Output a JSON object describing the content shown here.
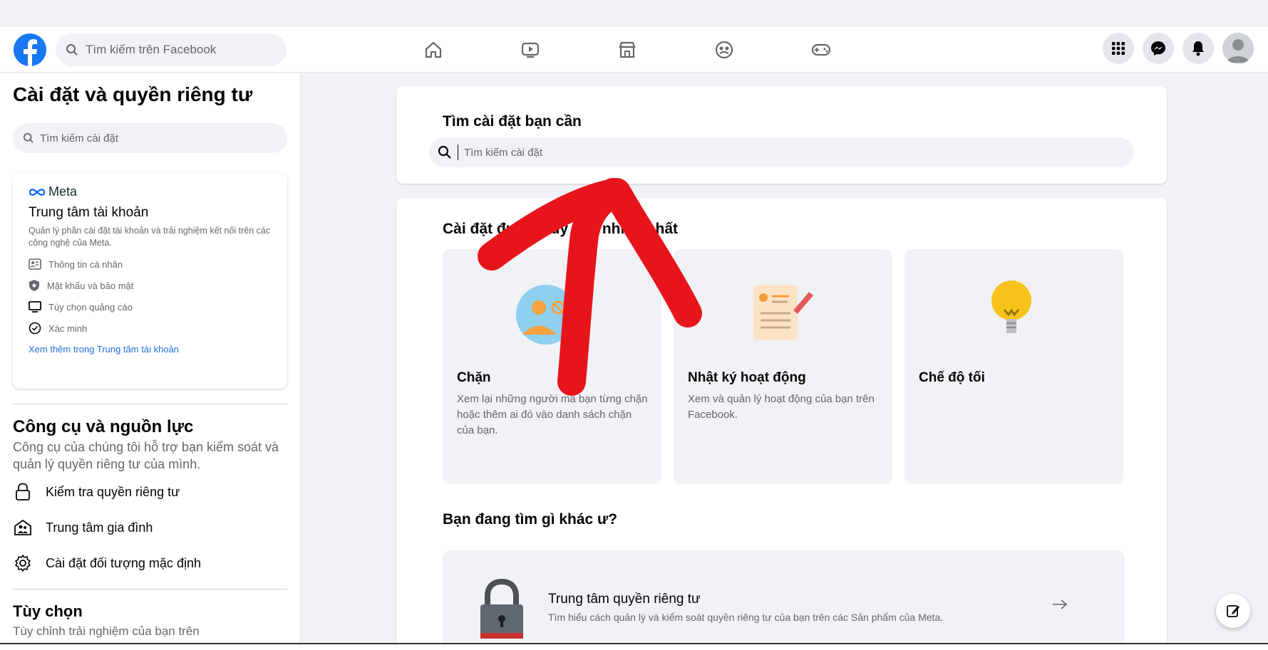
{
  "navbar": {
    "search_placeholder": "Tìm kiếm trên Facebook",
    "icons": [
      "home-icon",
      "video-icon",
      "marketplace-icon",
      "groups-icon",
      "gaming-icon"
    ],
    "right_icons": [
      "menu-grid-icon",
      "messenger-icon",
      "bell-icon",
      "avatar"
    ]
  },
  "sidebar": {
    "title": "Cài đặt và quyền riêng tư",
    "search_placeholder": "Tìm kiếm cài đặt",
    "meta_card": {
      "brand": "Meta",
      "title": "Trung tâm tài khoản",
      "description": "Quản lý phần cài đặt tài khoản và trải nghiệm kết nối trên các công nghệ của Meta.",
      "items": [
        {
          "label": "Thông tin cá nhân",
          "icon": "id-card-icon"
        },
        {
          "label": "Mật khẩu và bảo mật",
          "icon": "shield-icon"
        },
        {
          "label": "Tùy chọn quảng cáo",
          "icon": "monitor-icon"
        },
        {
          "label": "Xác minh",
          "icon": "check-circle-icon"
        }
      ],
      "link": "Xem thêm trong Trung tâm tài khoản"
    },
    "tools": {
      "heading": "Công cụ và nguồn lực",
      "subtitle": "Công cụ của chúng tôi hỗ trợ bạn kiểm soát và quản lý quyền riêng tư của mình.",
      "items": [
        {
          "label": "Kiểm tra quyền riêng tư",
          "icon": "lock-icon"
        },
        {
          "label": "Trung tâm gia đình",
          "icon": "family-icon"
        },
        {
          "label": "Cài đặt đối tượng mặc định",
          "icon": "gear-icon"
        }
      ]
    },
    "options": {
      "heading": "Tùy chọn",
      "subtitle": "Tùy chỉnh trải nghiệm của bạn trên"
    }
  },
  "main": {
    "search_card": {
      "title": "Tìm cài đặt bạn cần",
      "placeholder": "Tìm kiếm cài đặt"
    },
    "popular": {
      "title": "Cài đặt được truy cập nhiều nhất",
      "tiles": [
        {
          "title": "Chặn",
          "description": "Xem lại những người mà bạn từng chặn hoặc thêm ai đó vào danh sách chặn của bạn.",
          "icon": "block-user-icon"
        },
        {
          "title": "Nhật ký hoạt động",
          "description": "Xem và quản lý hoạt động của bạn trên Facebook.",
          "icon": "activity-log-icon"
        },
        {
          "title": "Chế độ tối",
          "description": "",
          "icon": "lightbulb-icon"
        }
      ],
      "other_title": "Bạn đang tìm gì khác ư?",
      "privacy_center": {
        "title": "Trung tâm quyền riêng tư",
        "description": "Tìm hiểu cách quản lý và kiểm soát quyền riêng tư của bạn trên các Sản phẩm của Meta.",
        "icon": "padlock-icon"
      }
    }
  },
  "colors": {
    "brand": "#1877f2",
    "annotation": "#e8141b",
    "background": "#f0f2f5"
  }
}
